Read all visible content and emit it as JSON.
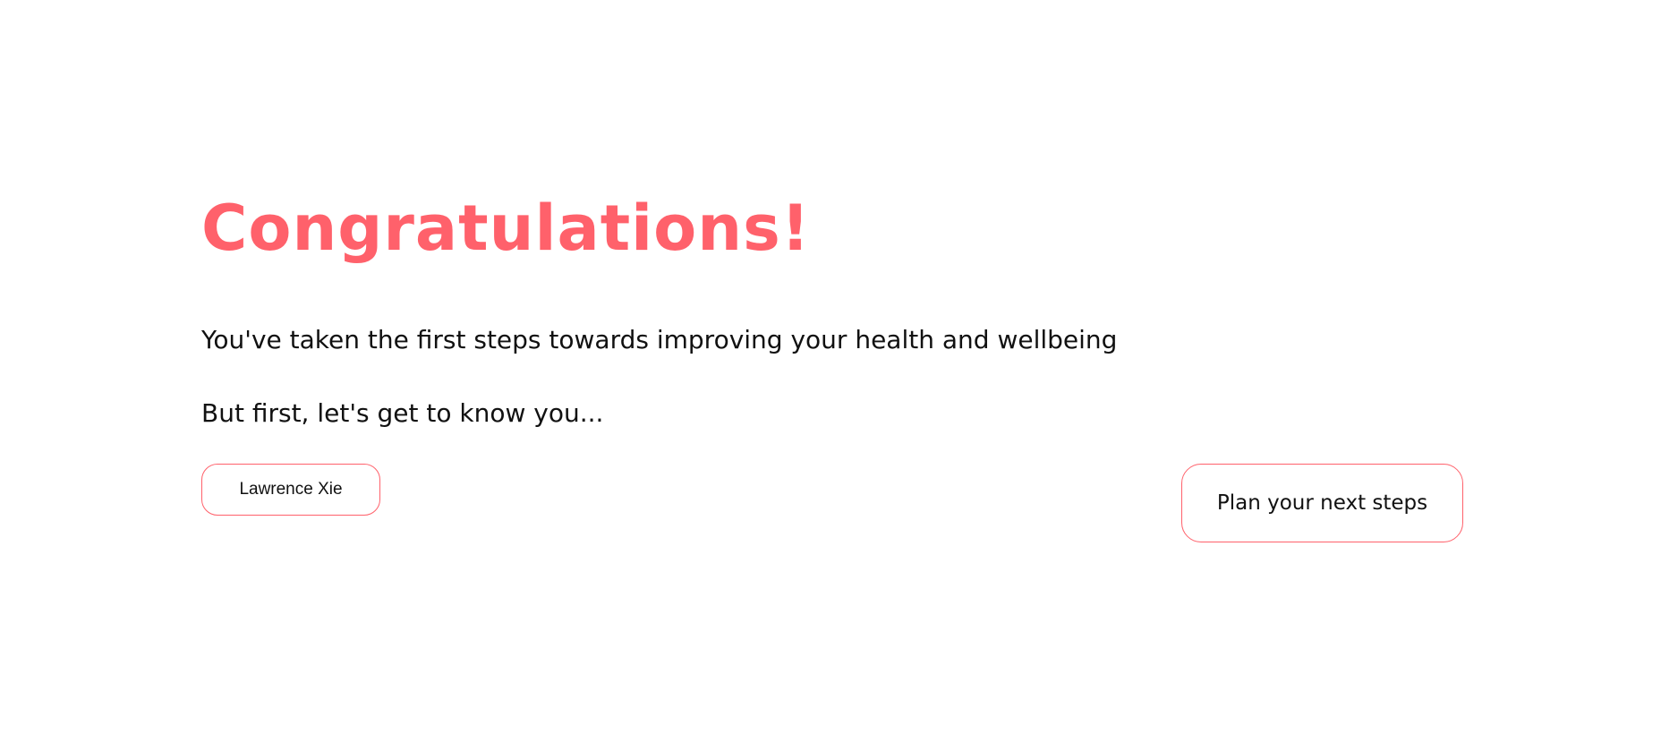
{
  "headline": "Congratulations!",
  "intro_text": "You've taken the first steps towards improving your health and wellbeing",
  "prompt_text": "But first, let's get to know you...",
  "name_field": {
    "value": "Lawrence Xie"
  },
  "next_button": {
    "label": "Plan your next steps"
  },
  "colors": {
    "accent": "#ff616b",
    "text": "#111111",
    "background": "#ffffff"
  }
}
